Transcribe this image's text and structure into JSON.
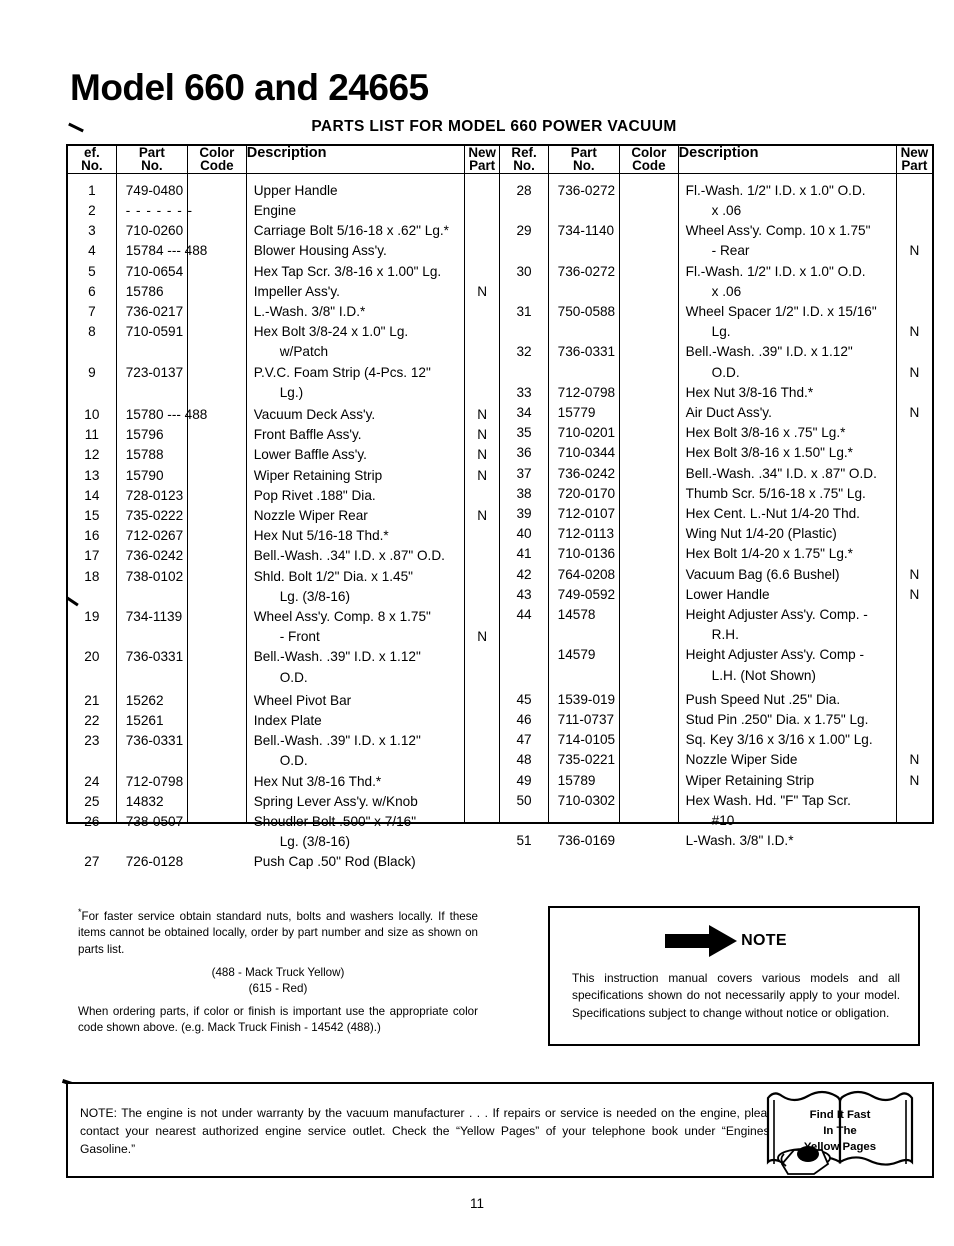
{
  "document": {
    "title": "Model 660 and 24665",
    "table_caption": "PARTS LIST FOR MODEL 660 POWER VACUUM",
    "page_number": "11"
  },
  "table": {
    "headers": {
      "ref_no": "Ref.\nNo.",
      "ref_no_l1": "ef.",
      "ref_no_l2": "No.",
      "part_no_l1": "Part",
      "part_no_l2": "No.",
      "color_code_l1": "Color",
      "color_code_l2": "Code",
      "description": "Description",
      "new_part_l1": "New",
      "new_part_l2": "Part",
      "ref_no_r_l1": "Ref.",
      "ref_no_r_l2": "No."
    },
    "left_rows": [
      {
        "ref": "1",
        "part": "749-0480",
        "color": "",
        "desc": [
          "Upper Handle"
        ],
        "new": ""
      },
      {
        "ref": "2",
        "part": "- - - - - - -",
        "color": "",
        "desc": [
          "Engine"
        ],
        "new": ""
      },
      {
        "ref": "3",
        "part": "710-0260",
        "color": "",
        "desc": [
          "Carriage Bolt 5/16-18 x .62\" Lg.*"
        ],
        "new": ""
      },
      {
        "ref": "4",
        "part": "15784 --- 488",
        "color": "",
        "desc": [
          "Blower Housing Ass'y."
        ],
        "new": ""
      },
      {
        "ref": "5",
        "part": "710-0654",
        "color": "",
        "desc": [
          "Hex Tap Scr. 3/8-16 x 1.00\" Lg."
        ],
        "new": ""
      },
      {
        "ref": "6",
        "part": "15786",
        "color": "",
        "desc": [
          "Impeller Ass'y."
        ],
        "new": "N"
      },
      {
        "ref": "7",
        "part": "736-0217",
        "color": "",
        "desc": [
          "L.-Wash. 3/8\" I.D.*"
        ],
        "new": ""
      },
      {
        "ref": "8",
        "part": "710-0591",
        "color": "",
        "desc": [
          "Hex Bolt 3/8-24 x 1.0\" Lg.",
          "w/Patch"
        ],
        "new": ""
      },
      {
        "ref": "9",
        "part": "723-0137",
        "color": "",
        "desc": [
          "P.V.C. Foam Strip (4-Pcs. 12\"",
          "Lg.)"
        ],
        "new": ""
      },
      {
        "ref": "10",
        "part": "15780 --- 488",
        "color": "",
        "desc": [
          "Vacuum Deck Ass'y."
        ],
        "new": "N"
      },
      {
        "ref": "11",
        "part": "15796",
        "color": "",
        "desc": [
          "Front Baffle Ass'y."
        ],
        "new": "N"
      },
      {
        "ref": "12",
        "part": "15788",
        "color": "",
        "desc": [
          "Lower Baffle Ass'y."
        ],
        "new": "N"
      },
      {
        "ref": "13",
        "part": "15790",
        "color": "",
        "desc": [
          "Wiper Retaining Strip"
        ],
        "new": "N"
      },
      {
        "ref": "14",
        "part": "728-0123",
        "color": "",
        "desc": [
          "Pop Rivet .188\" Dia."
        ],
        "new": ""
      },
      {
        "ref": "15",
        "part": "735-0222",
        "color": "",
        "desc": [
          "Nozzle Wiper Rear"
        ],
        "new": "N"
      },
      {
        "ref": "16",
        "part": "712-0267",
        "color": "",
        "desc": [
          "Hex Nut 5/16-18 Thd.*"
        ],
        "new": ""
      },
      {
        "ref": "17",
        "part": "736-0242",
        "color": "",
        "desc": [
          "Bell.-Wash. .34\" I.D. x .87\" O.D."
        ],
        "new": ""
      },
      {
        "ref": "18",
        "part": "738-0102",
        "color": "",
        "desc": [
          "Shld. Bolt 1/2\" Dia. x 1.45\"",
          "Lg. (3/8-16)"
        ],
        "new": ""
      },
      {
        "ref": "19",
        "part": "734-1139",
        "color": "",
        "desc": [
          "Wheel Ass'y. Comp. 8 x 1.75\"",
          "- Front"
        ],
        "new": "N"
      },
      {
        "ref": "20",
        "part": "736-0331",
        "color": "",
        "desc": [
          "Bell.-Wash. .39\" I.D. x 1.12\"",
          "O.D."
        ],
        "new": ""
      },
      {
        "ref": "21",
        "part": "15262",
        "color": "",
        "desc": [
          "Wheel Pivot Bar"
        ],
        "new": ""
      },
      {
        "ref": "22",
        "part": "15261",
        "color": "",
        "desc": [
          "Index Plate"
        ],
        "new": ""
      },
      {
        "ref": "23",
        "part": "736-0331",
        "color": "",
        "desc": [
          "Bell.-Wash. .39\" I.D. x 1.12\"",
          "O.D."
        ],
        "new": ""
      },
      {
        "ref": "24",
        "part": "712-0798",
        "color": "",
        "desc": [
          "Hex Nut 3/8-16 Thd.*"
        ],
        "new": ""
      },
      {
        "ref": "25",
        "part": "14832",
        "color": "",
        "desc": [
          "Spring Lever Ass'y. w/Knob"
        ],
        "new": ""
      },
      {
        "ref": "26",
        "part": "738-0507",
        "color": "",
        "desc": [
          "Shoudler Bolt .500\" x 7/16\"",
          "Lg. (3/8-16)"
        ],
        "new": ""
      },
      {
        "ref": "27",
        "part": "726-0128",
        "color": "",
        "desc": [
          "Push Cap .50\" Rod (Black)"
        ],
        "new": ""
      }
    ],
    "right_rows": [
      {
        "ref": "28",
        "part": "736-0272",
        "color": "",
        "desc": [
          "Fl.-Wash. 1/2\" I.D. x 1.0\" O.D.",
          "x .06"
        ],
        "new": ""
      },
      {
        "ref": "29",
        "part": "734-1140",
        "color": "",
        "desc": [
          "Wheel Ass'y. Comp. 10 x 1.75\"",
          "- Rear"
        ],
        "new": "N"
      },
      {
        "ref": "30",
        "part": "736-0272",
        "color": "",
        "desc": [
          "Fl.-Wash. 1/2\" I.D. x 1.0\" O.D.",
          "x .06"
        ],
        "new": ""
      },
      {
        "ref": "31",
        "part": "750-0588",
        "color": "",
        "desc": [
          "Wheel Spacer 1/2\" I.D. x 15/16\"",
          "Lg."
        ],
        "new": "N"
      },
      {
        "ref": "32",
        "part": "736-0331",
        "color": "",
        "desc": [
          "Bell.-Wash. .39\" I.D. x 1.12\"",
          "O.D."
        ],
        "new": "N"
      },
      {
        "ref": "33",
        "part": "712-0798",
        "color": "",
        "desc": [
          "Hex Nut 3/8-16 Thd.*"
        ],
        "new": ""
      },
      {
        "ref": "34",
        "part": "15779",
        "color": "",
        "desc": [
          "Air Duct Ass'y."
        ],
        "new": "N"
      },
      {
        "ref": "35",
        "part": "710-0201",
        "color": "",
        "desc": [
          "Hex Bolt 3/8-16 x .75\" Lg.*"
        ],
        "new": ""
      },
      {
        "ref": "36",
        "part": "710-0344",
        "color": "",
        "desc": [
          "Hex Bolt 3/8-16 x 1.50\" Lg.*"
        ],
        "new": ""
      },
      {
        "ref": "37",
        "part": "736-0242",
        "color": "",
        "desc": [
          "Bell.-Wash. .34\" I.D. x .87\" O.D."
        ],
        "new": ""
      },
      {
        "ref": "38",
        "part": "720-0170",
        "color": "",
        "desc": [
          "Thumb Scr. 5/16-18 x .75\" Lg."
        ],
        "new": ""
      },
      {
        "ref": "39",
        "part": "712-0107",
        "color": "",
        "desc": [
          "Hex Cent. L.-Nut 1/4-20 Thd."
        ],
        "new": ""
      },
      {
        "ref": "40",
        "part": "712-0113",
        "color": "",
        "desc": [
          "Wing Nut 1/4-20 (Plastic)"
        ],
        "new": ""
      },
      {
        "ref": "41",
        "part": "710-0136",
        "color": "",
        "desc": [
          "Hex Bolt 1/4-20 x 1.75\" Lg.*"
        ],
        "new": ""
      },
      {
        "ref": "42",
        "part": "764-0208",
        "color": "",
        "desc": [
          "Vacuum Bag  (6.6 Bushel)"
        ],
        "new": "N"
      },
      {
        "ref": "43",
        "part": "749-0592",
        "color": "",
        "desc": [
          "Lower Handle"
        ],
        "new": "N"
      },
      {
        "ref": "44",
        "part": "14578",
        "color": "",
        "desc": [
          "Height Adjuster Ass'y. Comp. -",
          "R.H."
        ],
        "new": ""
      },
      {
        "ref": "",
        "part": "14579",
        "color": "",
        "desc": [
          "Height Adjuster Ass'y. Comp -",
          "L.H. (Not Shown)"
        ],
        "new": ""
      },
      {
        "ref": "45",
        "part": "1539-019",
        "color": "",
        "desc": [
          "Push Speed Nut .25\" Dia."
        ],
        "new": ""
      },
      {
        "ref": "46",
        "part": "711-0737",
        "color": "",
        "desc": [
          "Stud Pin .250\" Dia. x 1.75\" Lg."
        ],
        "new": ""
      },
      {
        "ref": "47",
        "part": "714-0105",
        "color": "",
        "desc": [
          "Sq. Key 3/16 x 3/16 x 1.00\" Lg."
        ],
        "new": ""
      },
      {
        "ref": "48",
        "part": "735-0221",
        "color": "",
        "desc": [
          "Nozzle Wiper Side"
        ],
        "new": "N"
      },
      {
        "ref": "49",
        "part": "15789",
        "color": "",
        "desc": [
          "Wiper Retaining Strip"
        ],
        "new": "N"
      },
      {
        "ref": "50",
        "part": "710-0302",
        "color": "",
        "desc": [
          "Hex Wash. Hd. \"F\" Tap Scr.",
          "#10"
        ],
        "new": ""
      },
      {
        "ref": "51",
        "part": "736-0169",
        "color": "",
        "desc": [
          "L-Wash. 3/8\" I.D.*"
        ],
        "new": ""
      }
    ]
  },
  "footnote": {
    "paragraph1": "For faster service obtain standard nuts, bolts and washers locally. If these items cannot be obtained locally, order by part number and size as shown on parts list.",
    "color_code_1": "(488 - Mack Truck Yellow)",
    "color_code_2": "(615 - Red)",
    "paragraph2": "When ordering parts, if color or finish is important use the appropriate color code shown above. (e.g. Mack Truck Finish - 14542 (488).)"
  },
  "note_box": {
    "label": "NOTE",
    "text": "This instruction manual covers various models and all specifications shown do not necessarily apply to your model. Specifications subject to change without notice or obligation."
  },
  "warranty_box": {
    "text": "NOTE: The engine is not under warranty by the vacuum manufacturer . . . If repairs or service is needed on the engine, please contact your nearest authorized engine service outlet. Check the “Yellow Pages” of your telephone book under “Engines - Gasoline.”",
    "yellow_pages_l1": "Find It Fast",
    "yellow_pages_l2": "In The",
    "yellow_pages_l3": "Yellow Pages"
  },
  "colors": {
    "ink": "#000000",
    "paper": "#ffffff"
  }
}
